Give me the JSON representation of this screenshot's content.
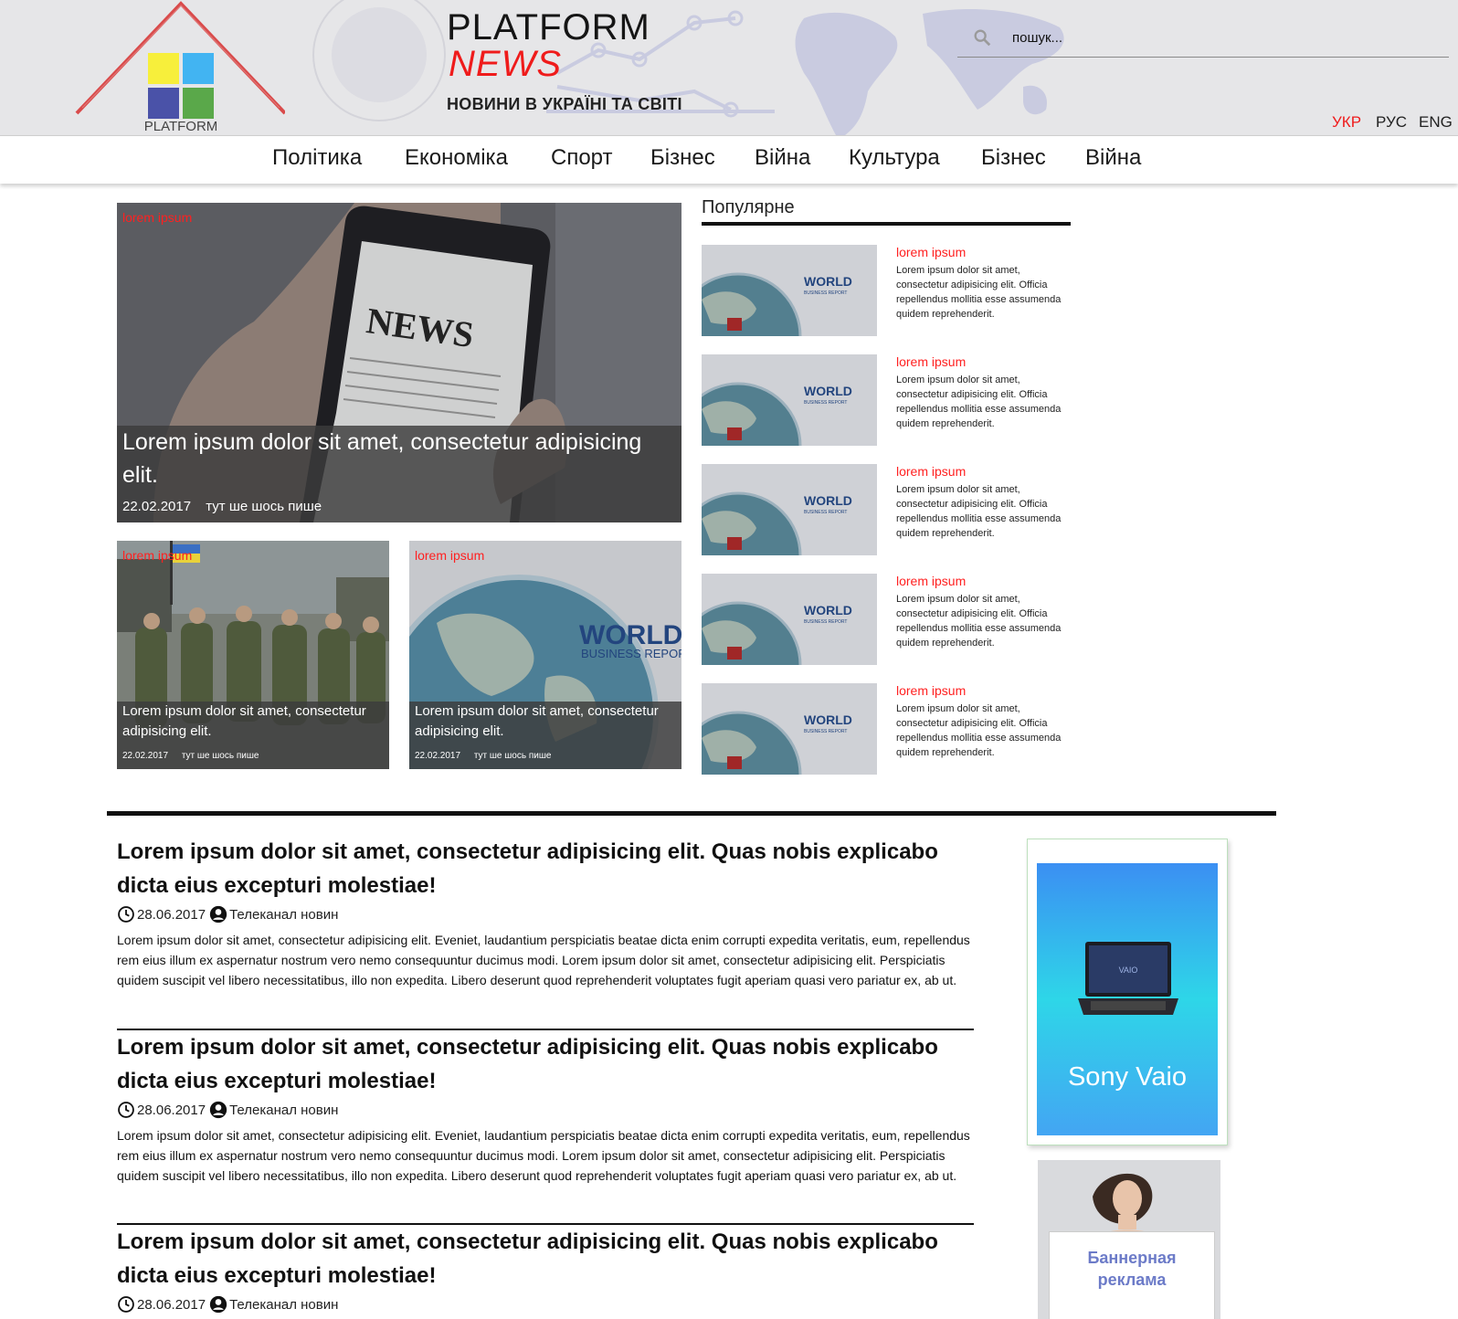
{
  "header": {
    "logo_text": "PLATFORM",
    "brand_line1": "PLATFORM",
    "brand_line2": "NEWS",
    "subtitle": "НОВИНИ В УКРАЇНІ ТА СВІТІ",
    "search": {
      "placeholder": "пошук...",
      "icon": "search-icon"
    },
    "languages": [
      {
        "label": "УКР",
        "active": true
      },
      {
        "label": "РУС",
        "active": false
      },
      {
        "label": "ENG",
        "active": false
      }
    ]
  },
  "nav": {
    "items": [
      "Політика",
      "Економіка",
      "Спорт",
      "Бізнес",
      "Війна",
      "Культура",
      "Бізнес",
      "Війна"
    ]
  },
  "hero": {
    "category": "lorem ipsum",
    "image_label": "NEWS",
    "title": "Lorem ipsum dolor sit amet, consectetur adipisicing elit.",
    "date": "22.02.2017",
    "author": "тут ше шось пише"
  },
  "secondary": [
    {
      "category": "lorem ipsum",
      "title": "Lorem ipsum dolor sit amet, consectetur adipisicing elit.",
      "date": "22.02.2017",
      "author": "тут ше шось пише"
    },
    {
      "category": "lorem ipsum",
      "image_label": "WORLD",
      "image_sublabel": "BUSINESS REPORT",
      "title": "Lorem ipsum dolor sit amet, consectetur adipisicing elit.",
      "date": "22.02.2017",
      "author": "тут ше шось пише"
    }
  ],
  "popular": {
    "heading": "Популярне",
    "thumb_label": "WORLD",
    "thumb_sublabel": "BUSINESS REPORT",
    "items": [
      {
        "category": "lorem ipsum",
        "text": "Lorem ipsum dolor sit amet, consectetur adipisicing elit. Officia repellendus mollitia esse assumenda quidem reprehenderit."
      },
      {
        "category": "lorem ipsum",
        "text": "Lorem ipsum dolor sit amet, consectetur adipisicing elit. Officia repellendus mollitia esse assumenda quidem reprehenderit."
      },
      {
        "category": "lorem ipsum",
        "text": "Lorem ipsum dolor sit amet, consectetur adipisicing elit. Officia repellendus mollitia esse assumenda quidem reprehenderit."
      },
      {
        "category": "lorem ipsum",
        "text": "Lorem ipsum dolor sit amet, consectetur adipisicing elit. Officia repellendus mollitia esse assumenda quidem reprehenderit."
      },
      {
        "category": "lorem ipsum",
        "text": "Lorem ipsum dolor sit amet, consectetur adipisicing elit. Officia repellendus mollitia esse assumenda quidem reprehenderit."
      }
    ]
  },
  "articles": [
    {
      "title": "Lorem ipsum dolor sit amet, consectetur adipisicing elit. Quas nobis explicabo dicta eius excepturi molestiae!",
      "date": "28.06.2017",
      "author": "Телеканал новин",
      "body": "Lorem ipsum dolor sit amet, consectetur adipisicing elit. Eveniet, laudantium perspiciatis beatae dicta enim corrupti expedita veritatis, eum, repellendus rem eius illum ex aspernatur nostrum vero nemo consequuntur ducimus modi. Lorem ipsum dolor sit amet, consectetur adipisicing elit. Perspiciatis quidem suscipit vel libero necessitatibus, illo non expedita. Libero deserunt quod reprehenderit voluptates fugit aperiam quasi vero pariatur ex, ab ut."
    },
    {
      "title": "Lorem ipsum dolor sit amet, consectetur adipisicing elit. Quas nobis explicabo dicta eius excepturi molestiae!",
      "date": "28.06.2017",
      "author": "Телеканал новин",
      "body": "Lorem ipsum dolor sit amet, consectetur adipisicing elit. Eveniet, laudantium perspiciatis beatae dicta enim corrupti expedita veritatis, eum, repellendus rem eius illum ex aspernatur nostrum vero nemo consequuntur ducimus modi. Lorem ipsum dolor sit amet, consectetur adipisicing elit. Perspiciatis quidem suscipit vel libero necessitatibus, illo non expedita. Libero deserunt quod reprehenderit voluptates fugit aperiam quasi vero pariatur ex, ab ut."
    },
    {
      "title": "Lorem ipsum dolor sit amet, consectetur adipisicing elit. Quas nobis explicabo dicta eius excepturi molestiae!",
      "date": "28.06.2017",
      "author": "Телеканал новин",
      "body": ""
    }
  ],
  "ads": {
    "laptop": {
      "text": "Sony Vaio",
      "brand": "VAIO"
    },
    "banner": {
      "text_line1": "Баннерная",
      "text_line2": "реклама"
    }
  },
  "colors": {
    "accent": "#ef1b1b",
    "header_bg": "#e6e6e8",
    "logo_roof": "#d94b4b",
    "logo_yellow": "#f7ef3b",
    "logo_blue": "#42b4f2",
    "logo_navy": "#4a52a8",
    "logo_green": "#5aa84a"
  }
}
